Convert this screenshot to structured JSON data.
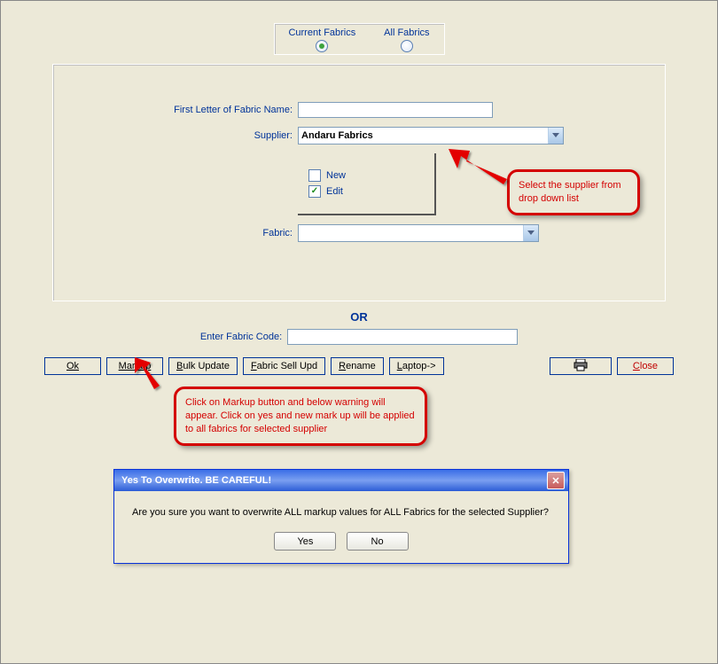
{
  "radios": {
    "current": "Current Fabrics",
    "all": "All Fabrics",
    "selected": "current"
  },
  "form": {
    "first_letter_label": "First Letter of Fabric Name:",
    "first_letter_value": "",
    "supplier_label": "Supplier:",
    "supplier_value": "Andaru Fabrics",
    "fabric_label": "Fabric:",
    "fabric_value": "",
    "new_label": "New",
    "new_checked": false,
    "edit_label": "Edit",
    "edit_checked": true
  },
  "or_label": "OR",
  "code": {
    "label": "Enter Fabric Code:",
    "value": ""
  },
  "buttons": {
    "ok": "Ok",
    "markup": "Markup",
    "bulk_update": "Bulk Update",
    "fabric_sell_upd": "Fabric Sell Upd",
    "rename": "Rename",
    "laptop": "Laptop->",
    "close": "Close"
  },
  "callouts": {
    "supplier": "Select  the supplier from drop down list",
    "markup": "Click on Markup button and below warning will appear. Click on yes and new mark up will be applied to all fabrics for selected supplier"
  },
  "dialog": {
    "title": "Yes To Overwrite. BE CAREFUL!",
    "message": "Are you sure you want to overwrite ALL markup values for ALL Fabrics for the selected Supplier?",
    "yes": "Yes",
    "no": "No"
  }
}
